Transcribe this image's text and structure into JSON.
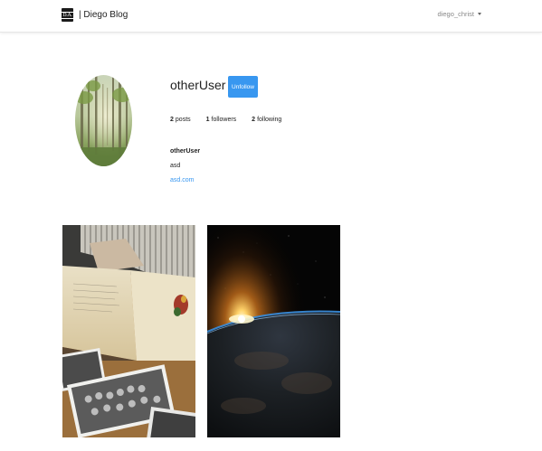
{
  "nav": {
    "brand_logo_text": "D.A.",
    "brand_text": "| Diego Blog",
    "current_user": "diego_christ"
  },
  "profile": {
    "username": "otherUser",
    "follow_button_label": "Unfollow",
    "stats": [
      {
        "count": "2",
        "label": "posts"
      },
      {
        "count": "1",
        "label": "followers"
      },
      {
        "count": "2",
        "label": "following"
      }
    ],
    "bio_name": "otherUser",
    "bio_text": "asd",
    "bio_link": "asd.com"
  },
  "posts": [
    {
      "subject": "open book and old photographs"
    },
    {
      "subject": "sunrise over earth from space"
    }
  ],
  "colors": {
    "accent": "#3897f0",
    "text": "#222222",
    "muted": "#888888"
  }
}
